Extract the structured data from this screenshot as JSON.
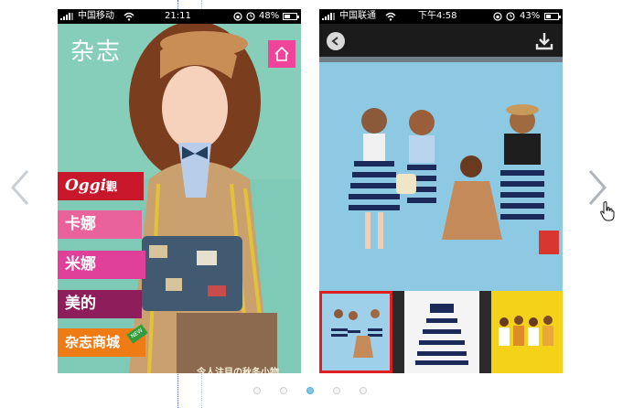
{
  "phone_left": {
    "status": {
      "carrier": "中国移动",
      "time": "21:11",
      "battery": "48%"
    },
    "logo": "杂志",
    "menu": [
      {
        "label": "Oggi",
        "suffix": "觀"
      },
      {
        "label": "卡娜"
      },
      {
        "label": "米娜"
      },
      {
        "label": "美的"
      },
      {
        "label": "杂志商城"
      }
    ],
    "new_badge": "NEW",
    "caption": "令人注目の秋冬小物",
    "icons": {
      "home": "home-icon"
    }
  },
  "phone_right": {
    "status": {
      "carrier": "中国联通",
      "time": "下午4:58",
      "battery": "43%"
    },
    "icons": {
      "back": "back-arrow-icon",
      "download": "download-icon"
    },
    "thumbnails": [
      "group-photo",
      "striped-dress",
      "yellow-group"
    ],
    "selected_thumbnail": 0
  },
  "carousel": {
    "pages": 5,
    "active_page": 2
  },
  "colors": {
    "accent_red": "#c8172b",
    "accent_pink": "#f0439a",
    "active_dot": "#7cc7e8"
  }
}
